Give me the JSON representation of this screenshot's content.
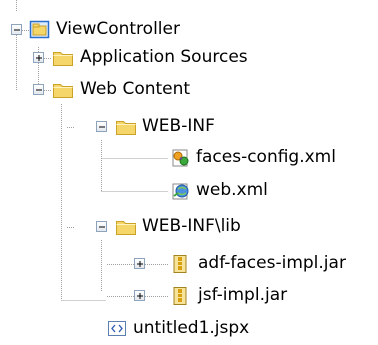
{
  "tree": {
    "nodes": [
      {
        "id": "viewcontroller",
        "label": "ViewController",
        "icon": "project-icon",
        "level": 0,
        "toggle": "expanded"
      },
      {
        "id": "application-sources",
        "label": "Application Sources",
        "icon": "folder-icon",
        "level": 1,
        "toggle": "collapsed"
      },
      {
        "id": "web-content",
        "label": "Web Content",
        "icon": "folder-icon",
        "level": 1,
        "toggle": "expanded"
      },
      {
        "id": "web-inf",
        "label": "WEB-INF",
        "icon": "folder-icon",
        "level": 2,
        "toggle": "expanded"
      },
      {
        "id": "faces-config",
        "label": "faces-config.xml",
        "icon": "faces-config-icon",
        "level": 3,
        "toggle": "none"
      },
      {
        "id": "web-xml",
        "label": "web.xml",
        "icon": "web-xml-icon",
        "level": 3,
        "toggle": "none"
      },
      {
        "id": "web-inf-lib",
        "label": "WEB-INF\\lib",
        "icon": "folder-icon",
        "level": 2,
        "toggle": "expanded"
      },
      {
        "id": "adf-faces-impl",
        "label": "adf-faces-impl.jar",
        "icon": "jar-icon",
        "level": 3,
        "toggle": "collapsed"
      },
      {
        "id": "jsf-impl",
        "label": "jsf-impl.jar",
        "icon": "jar-icon",
        "level": 3,
        "toggle": "collapsed"
      },
      {
        "id": "untitled1",
        "label": "untitled1.jspx",
        "icon": "jspx-icon",
        "level": 2,
        "toggle": "none"
      }
    ]
  },
  "colors": {
    "folder": "#f5d66b",
    "folder_dark": "#c9a227",
    "project_frame": "#2a6fc9",
    "connector": "#a0a0a0",
    "toggle_border": "#8ea3bc"
  }
}
